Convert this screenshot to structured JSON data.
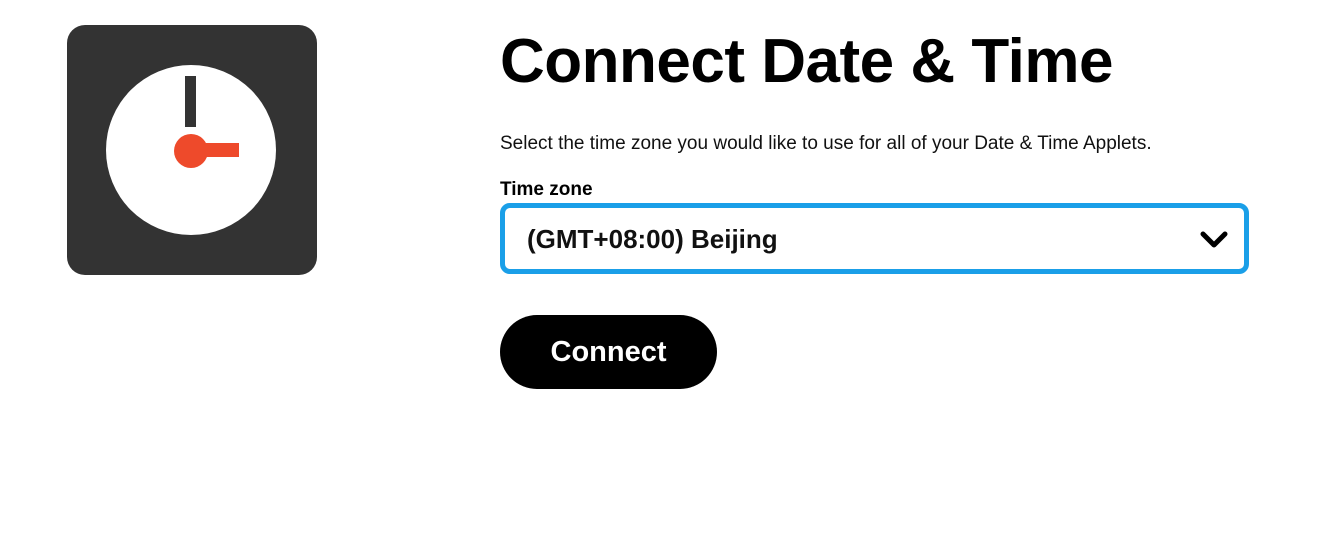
{
  "service": {
    "icon": "clock-icon",
    "colors": {
      "tile": "#333333",
      "face": "#ffffff",
      "hour_hand": "#333333",
      "minute_hand": "#ee4a2b"
    }
  },
  "header": {
    "title": "Connect Date & Time"
  },
  "form": {
    "description": "Select the time zone you would like to use for all of your Date & Time Applets.",
    "timezone_label": "Time zone",
    "timezone_value": "(GMT+08:00) Beijing",
    "dropdown_icon": "chevron-down-icon",
    "focus_color": "#1a9fe8"
  },
  "actions": {
    "connect_label": "Connect",
    "button_color": "#000000"
  }
}
